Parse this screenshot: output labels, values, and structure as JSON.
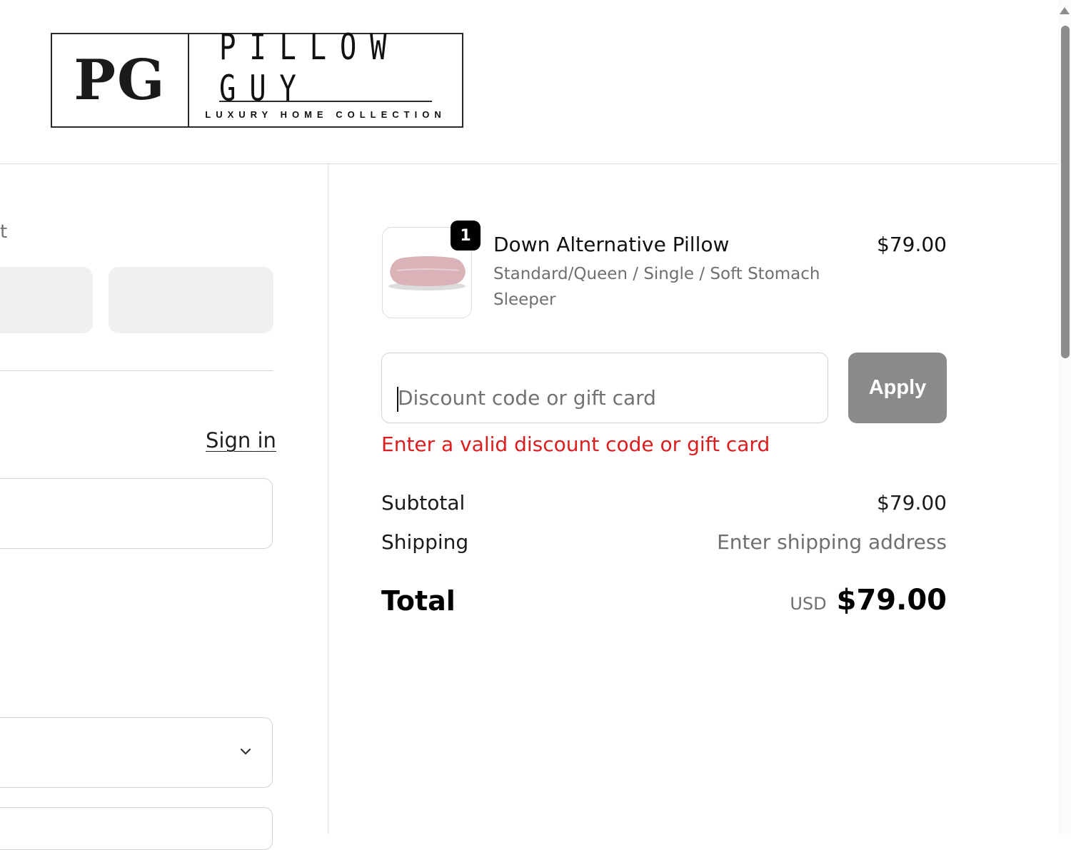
{
  "brand": {
    "monogram": "PG",
    "name": "PILLOW GUY",
    "tagline": "LUXURY HOME COLLECTION"
  },
  "left": {
    "text_fragment": "t",
    "sign_in": "Sign in"
  },
  "cart": {
    "item": {
      "quantity": "1",
      "title": "Down Alternative Pillow",
      "variant": "Standard/Queen / Single / Soft Stomach Sleeper",
      "price": "$79.00",
      "image_color": "#d9b3b8"
    }
  },
  "discount": {
    "placeholder": "Discount code or gift card",
    "value": "",
    "apply_label": "Apply",
    "error": "Enter a valid discount code or gift card",
    "error_color": "#dd1d1d"
  },
  "summary": {
    "subtotal_label": "Subtotal",
    "subtotal_value": "$79.00",
    "shipping_label": "Shipping",
    "shipping_value": "Enter shipping address",
    "total_label": "Total",
    "currency": "USD",
    "total_value": "$79.00"
  }
}
